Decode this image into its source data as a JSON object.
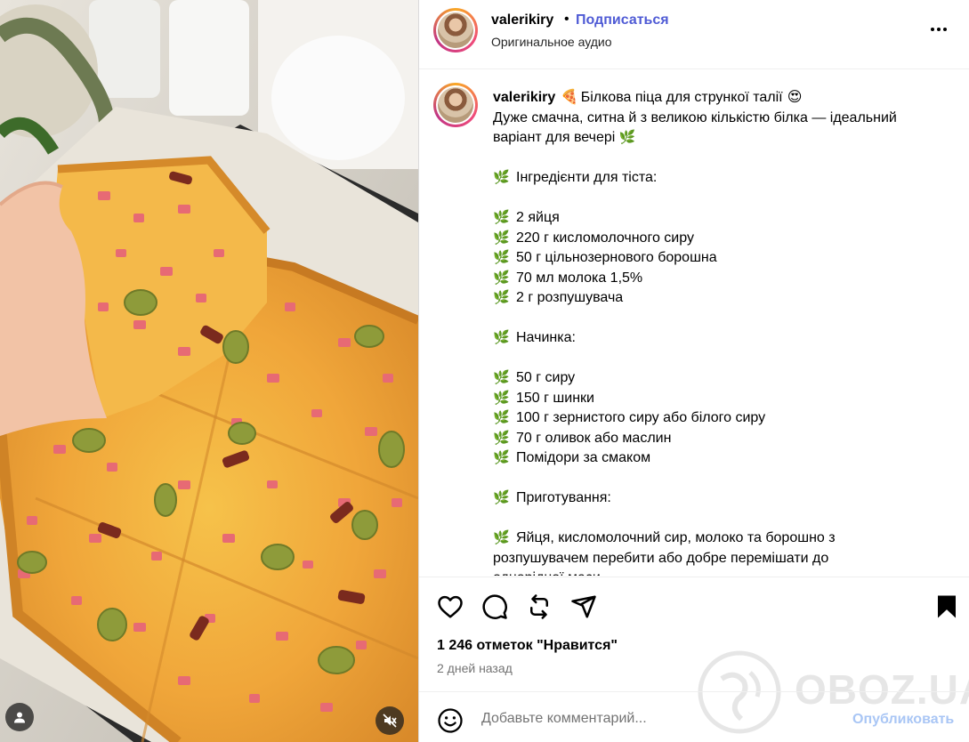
{
  "post": {
    "username": "valerikiry",
    "separator": "•",
    "follow_label": "Подписаться",
    "audio_label": "Оригинальное аудио"
  },
  "caption": {
    "username": "valerikiry",
    "title": "Білкова піца для стрункої талії",
    "intro_line1": "Дуже смачна, ситна й з великою кількістю білка — ідеальний",
    "intro_line2": "варіант для вечері",
    "dough_heading": "Інгредієнти для тіста:",
    "dough": [
      "2 яйця",
      "220 г кисломолочного сиру",
      "50 г цільнозернового борошна",
      "70 мл молока 1,5%",
      "2 г розпушувача"
    ],
    "filling_heading": "Начинка:",
    "filling": [
      "50 г сиру",
      "150 г шинки",
      "100 г зернистого сиру або білого сиру",
      "70 г оливок або маслин",
      "Помідори за смаком"
    ],
    "prep_heading": "Приготування:",
    "prep_line1": "Яйця, кисломолочний сир, молоко та борошно з",
    "prep_line2": "розпушувачем перебити або добре перемішати до",
    "prep_line3": "однорідної маси"
  },
  "emojis": {
    "pizza": "🍕",
    "heart_eyes": "😍",
    "herb": "🌿"
  },
  "stats": {
    "likes": "1 246 отметок \"Нравится\"",
    "date": "2 дней назад"
  },
  "comment": {
    "placeholder": "Добавьте комментарий...",
    "publish_label": "Опубликовать"
  },
  "watermark": {
    "text": "OBOZ.UA"
  },
  "icons": {
    "like": "heart-icon",
    "comment": "comment-icon",
    "repost": "repost-icon",
    "share": "share-icon",
    "save": "bookmark-icon",
    "emoji": "emoji-icon",
    "tag": "user-tag-icon",
    "mute": "mute-icon",
    "more": "more-icon"
  },
  "colors": {
    "follow": "#4f5bd5",
    "publish_disabled": "#a9c6f5",
    "herb": "#6fa83a",
    "secondary_text": "#737373"
  }
}
